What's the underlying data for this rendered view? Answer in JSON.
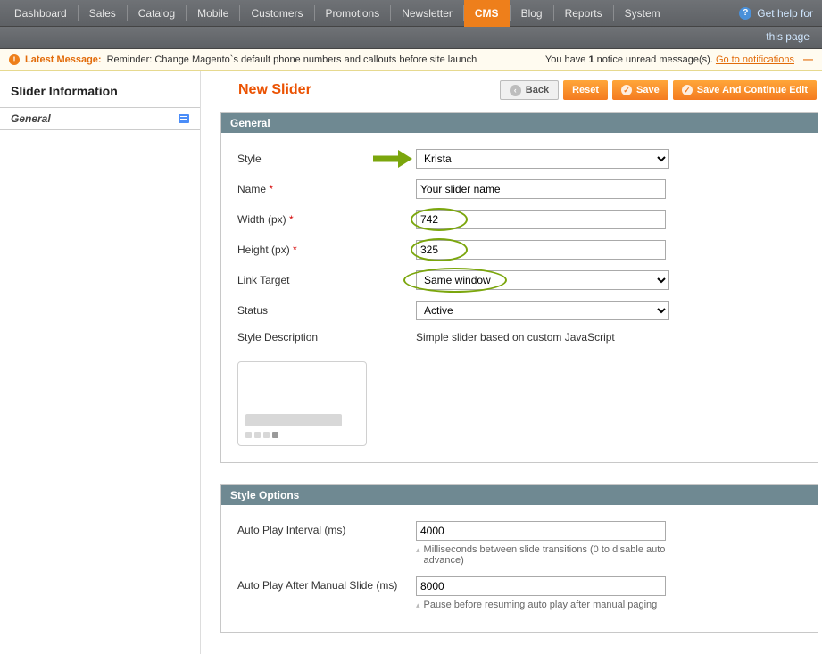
{
  "nav": {
    "items": [
      "Dashboard",
      "Sales",
      "Catalog",
      "Mobile",
      "Customers",
      "Promotions",
      "Newsletter",
      "CMS",
      "Blog",
      "Reports",
      "System"
    ],
    "active": "CMS",
    "help1": "Get help for",
    "help2": "this page"
  },
  "msg": {
    "latest_label": "Latest Message:",
    "latest_text": "Reminder: Change Magento`s default phone numbers and callouts before site launch",
    "notice_prefix": "You have ",
    "notice_count": "1",
    "notice_suffix": " notice unread message(s). ",
    "notice_link": "Go to notifications"
  },
  "sidebar": {
    "title": "Slider Information",
    "tab_general": "General"
  },
  "page": {
    "title": "New Slider",
    "btn_back": "Back",
    "btn_reset": "Reset",
    "btn_save": "Save",
    "btn_savecont": "Save And Continue Edit"
  },
  "general": {
    "panel_title": "General",
    "style_label": "Style",
    "style_value": "Krista",
    "name_label": "Name",
    "name_value": "Your slider name",
    "width_label": "Width (px)",
    "width_value": "742",
    "height_label": "Height (px)",
    "height_value": "325",
    "linktarget_label": "Link Target",
    "linktarget_value": "Same window",
    "status_label": "Status",
    "status_value": "Active",
    "styledesc_label": "Style Description",
    "styledesc_value": "Simple slider based on custom JavaScript"
  },
  "styleopts": {
    "panel_title": "Style Options",
    "autoplay_label": "Auto Play Interval (ms)",
    "autoplay_value": "4000",
    "autoplay_hint": "Milliseconds between slide transitions (0 to disable auto advance)",
    "aftermanual_label": "Auto Play After Manual Slide (ms)",
    "aftermanual_value": "8000",
    "aftermanual_hint": "Pause before resuming auto play after manual paging"
  }
}
